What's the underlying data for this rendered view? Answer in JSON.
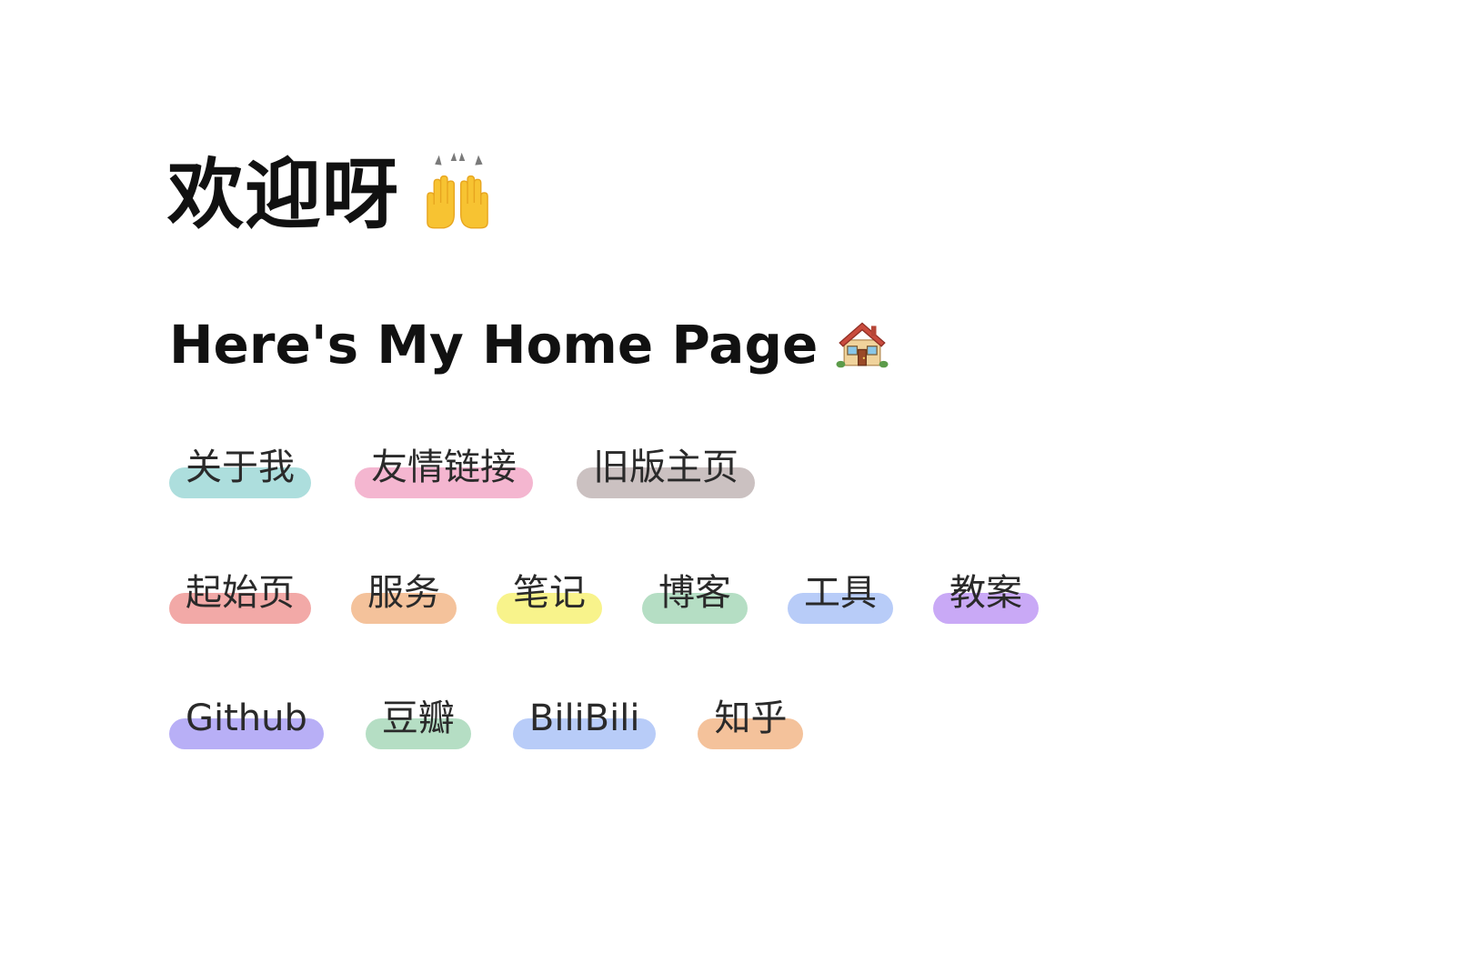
{
  "header": {
    "title": "欢迎呀",
    "subtitle": "Here's My Home Page",
    "title_icon": "raising-hands-icon",
    "subtitle_icon": "house-icon"
  },
  "colors": {
    "teal": "#ADDEDD",
    "pink": "#F4B6D0",
    "gray": "#CBC1C1",
    "salmon": "#F2A9A7",
    "orange": "#F4C29B",
    "yellow": "#F8F38B",
    "green": "#B5DEC4",
    "blue": "#B8CCF8",
    "purple": "#C9A9F6",
    "violet": "#B8AFF6"
  },
  "links": {
    "row1": [
      {
        "label": "关于我",
        "color": "#ADDEDD"
      },
      {
        "label": "友情链接",
        "color": "#F4B6D0"
      },
      {
        "label": "旧版主页",
        "color": "#CBC1C1"
      }
    ],
    "row2": [
      {
        "label": "起始页",
        "color": "#F2A9A7"
      },
      {
        "label": "服务",
        "color": "#F4C29B"
      },
      {
        "label": "笔记",
        "color": "#F8F38B"
      },
      {
        "label": "博客",
        "color": "#B5DEC4"
      },
      {
        "label": "工具",
        "color": "#B8CCF8"
      },
      {
        "label": "教案",
        "color": "#C9A9F6"
      }
    ],
    "row3": [
      {
        "label": "Github",
        "color": "#B8AFF6"
      },
      {
        "label": "豆瓣",
        "color": "#B5DEC4"
      },
      {
        "label": "BiliBili",
        "color": "#B8CCF8"
      },
      {
        "label": "知乎",
        "color": "#F4C29B"
      }
    ]
  }
}
